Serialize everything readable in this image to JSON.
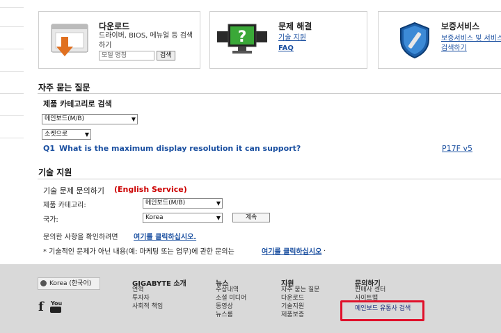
{
  "cards": {
    "download": {
      "title": "다운로드",
      "desc": "드라이버, BIOS, 메뉴얼 등 검색하기",
      "input_placeholder": "모델 명칭",
      "search_btn": "검색"
    },
    "troubleshoot": {
      "title": "문제 해결",
      "link1": "기술 지원",
      "link2": "FAQ"
    },
    "warranty": {
      "title": "보증서비스",
      "link1": "보증서비스 및 서비스",
      "link2": "검색하기"
    }
  },
  "faq": {
    "heading": "자주 묻는 질문",
    "sub": "제품 카테고리로 검색",
    "category_select": "메인보드(M/B)",
    "model_select": "소켓으로",
    "q_label": "Q1",
    "q_text": "What is the maximum display resolution it can support?",
    "q_model": "P17F v5"
  },
  "support": {
    "heading": "기술 지원",
    "sub": "기술 문제 문의하기",
    "sub_note": "(English Service)",
    "category_label": "제품 카테고리:",
    "category_value": "메인보드(M/B)",
    "country_label": "국가:",
    "country_value": "Korea",
    "continue_btn": "계속",
    "check_text": "문의한 사항을 확인하려면",
    "check_link": "여기를 클릭하십시오.",
    "note_text": "* 기술적인 문제가 아닌 내용(예: 마케팅 또는 업무)에 관한 문의는",
    "note_link": "여기를 클릭하십시오",
    "note_end": "."
  },
  "footer": {
    "region": "Korea (한국어)",
    "col1": {
      "title": "GIGABYTE 소개",
      "items": [
        "연혁",
        "투자자",
        "사회적 책임"
      ]
    },
    "col2": {
      "title": "뉴스",
      "items": [
        "수상내역",
        "소셜 미디어",
        "동영상",
        "뉴스룸"
      ]
    },
    "col3": {
      "title": "지원",
      "items": [
        "자주 묻는 질문",
        "다운로드",
        "기술지원",
        "제품보증"
      ]
    },
    "col4": {
      "title": "문의하기",
      "items": [
        "판매사 센터",
        "사이트맵",
        "메인보드 유통사 검색"
      ]
    },
    "youtube_label": "You"
  },
  "colors": {
    "link": "#1a4fa0",
    "highlight": "#e0102a",
    "english_note": "#cc0000",
    "footer_bg": "#d9d9d9"
  }
}
